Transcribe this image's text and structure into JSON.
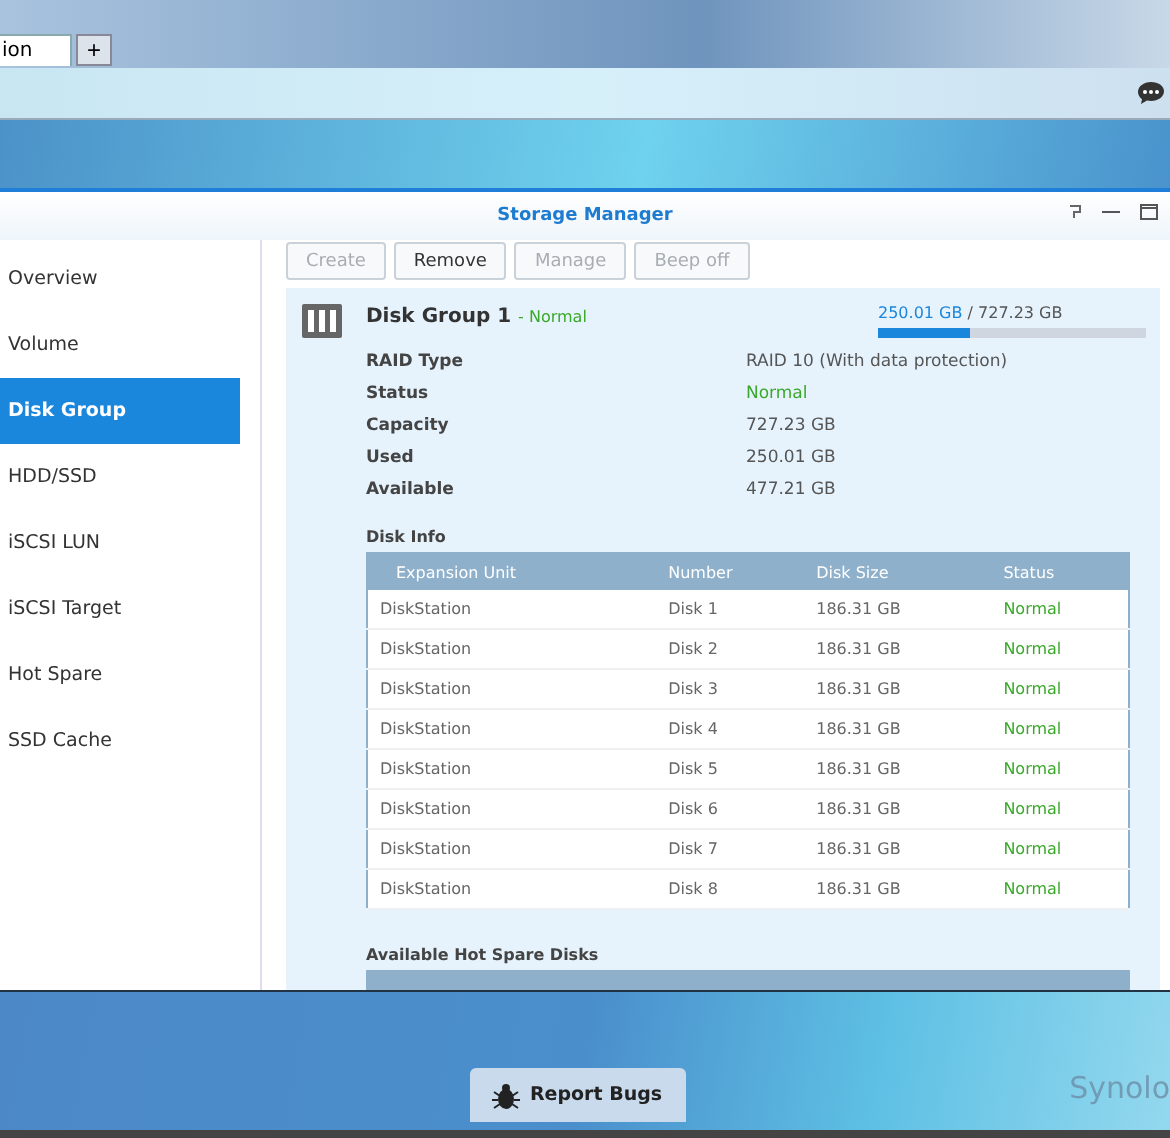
{
  "browser": {
    "tab_label": "ion",
    "new_tab": "+"
  },
  "window": {
    "title": "Storage Manager"
  },
  "sidebar": {
    "items": [
      {
        "label": "Overview",
        "selected": false
      },
      {
        "label": "Volume",
        "selected": false
      },
      {
        "label": "Disk Group",
        "selected": true
      },
      {
        "label": "HDD/SSD",
        "selected": false
      },
      {
        "label": "iSCSI LUN",
        "selected": false
      },
      {
        "label": "iSCSI Target",
        "selected": false
      },
      {
        "label": "Hot Spare",
        "selected": false
      },
      {
        "label": "SSD Cache",
        "selected": false
      }
    ]
  },
  "toolbar": [
    {
      "label": "Create",
      "disabled": true
    },
    {
      "label": "Remove",
      "disabled": false
    },
    {
      "label": "Manage",
      "disabled": true
    },
    {
      "label": "Beep off",
      "disabled": true
    }
  ],
  "disk_group": {
    "title": "Disk Group 1",
    "separator": "-",
    "status": "Normal",
    "used": "250.01 GB",
    "total": "/ 727.23 GB",
    "usage": {
      "level": 0.344
    },
    "properties": [
      {
        "label": "RAID Type",
        "value": "RAID 10 (With data protection)",
        "kind": "plain"
      },
      {
        "label": "Status",
        "value": "Normal",
        "kind": "status"
      },
      {
        "label": "Capacity",
        "value": "727.23 GB",
        "kind": "plain"
      },
      {
        "label": "Used",
        "value": "250.01 GB",
        "kind": "plain"
      },
      {
        "label": "Available",
        "value": "477.21 GB",
        "kind": "plain"
      }
    ]
  },
  "disk_info": {
    "title": "Disk Info",
    "columns": [
      "Expansion Unit",
      "Number",
      "Disk Size",
      "Status"
    ],
    "rows": [
      [
        "DiskStation",
        "Disk 1",
        "186.31 GB",
        "Normal"
      ],
      [
        "DiskStation",
        "Disk 2",
        "186.31 GB",
        "Normal"
      ],
      [
        "DiskStation",
        "Disk 3",
        "186.31 GB",
        "Normal"
      ],
      [
        "DiskStation",
        "Disk 4",
        "186.31 GB",
        "Normal"
      ],
      [
        "DiskStation",
        "Disk 5",
        "186.31 GB",
        "Normal"
      ],
      [
        "DiskStation",
        "Disk 6",
        "186.31 GB",
        "Normal"
      ],
      [
        "DiskStation",
        "Disk 7",
        "186.31 GB",
        "Normal"
      ],
      [
        "DiskStation",
        "Disk 8",
        "186.31 GB",
        "Normal"
      ]
    ]
  },
  "hot_spare": {
    "title": "Available Hot Spare Disks"
  },
  "taskbar": {
    "report_bugs": "Report Bugs",
    "brand": "Synolo"
  }
}
